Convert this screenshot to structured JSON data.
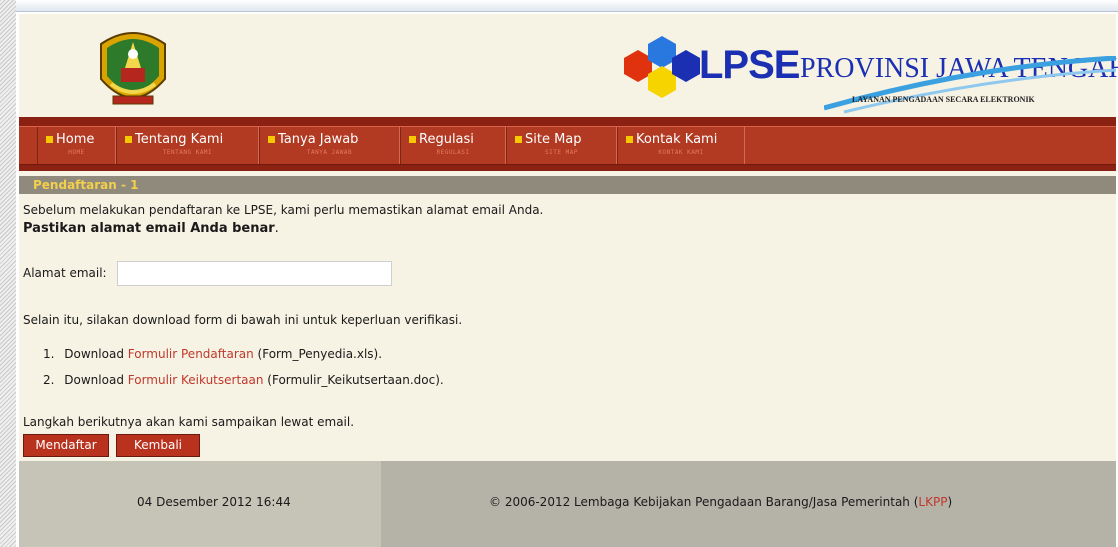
{
  "brand": {
    "name": "LPSE",
    "region": "PROVINSI JAWA TENGAH",
    "tagline": "LAYANAN PENGADAAN SECARA ELEKTRONIK",
    "logo": "province-coat-of-arms-icon"
  },
  "nav": {
    "items": [
      {
        "label": "Home",
        "sub": "HOME"
      },
      {
        "label": "Tentang Kami",
        "sub": "TENTANG KAMI"
      },
      {
        "label": "Tanya Jawab",
        "sub": "TANYA JAWAB"
      },
      {
        "label": "Regulasi",
        "sub": "REGULASI"
      },
      {
        "label": "Site Map",
        "sub": "SITE MAP"
      },
      {
        "label": "Kontak Kami",
        "sub": "KONTAK KAMI"
      }
    ]
  },
  "section": {
    "title": "Pendaftaran - 1"
  },
  "intro": {
    "line1": "Sebelum melakukan pendaftaran ke LPSE, kami perlu memastikan alamat email Anda.",
    "line2": "Pastikan alamat email Anda benar",
    "line2_end": "."
  },
  "form": {
    "email_label": "Alamat email:",
    "email_value": "",
    "email_placeholder": ""
  },
  "download": {
    "intro": "Selain itu, silakan download form di bawah ini untuk keperluan verifikasi.",
    "items": [
      {
        "num": "1.",
        "prefix": "Download ",
        "link": "Formulir Pendaftaran",
        "suffix": " (Form_Penyedia.xls)."
      },
      {
        "num": "2.",
        "prefix": "Download ",
        "link": "Formulir Keikutsertaan",
        "suffix": " (Formulir_Keikutsertaan.doc)."
      }
    ]
  },
  "next_step": "Langkah berikutnya akan kami sampaikan lewat email.",
  "buttons": {
    "register": "Mendaftar",
    "back": "Kembali"
  },
  "footer": {
    "date": "04 Desember 2012 16:44",
    "copyright": "© 2006-2012 Lembaga Kebijakan Pengadaan Barang/Jasa Pemerintah (",
    "link": "LKPP",
    "close": ")"
  },
  "colors": {
    "nav_bg": "#b23a22",
    "section_title": "#f4cf4a",
    "link": "#c0392b",
    "brand_blue": "#1b2fb3"
  }
}
